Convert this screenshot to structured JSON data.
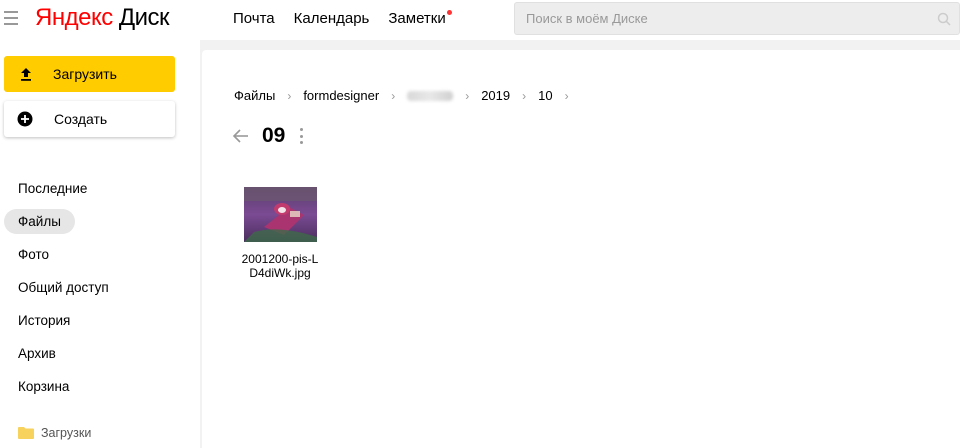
{
  "header": {
    "logo_brand_initial": "Я",
    "logo_brand_rest": "ндекс",
    "logo_product": "Диск",
    "nav": [
      "Почта",
      "Календарь",
      "Заметки"
    ],
    "search_placeholder": "Поиск в моём Диске"
  },
  "sidebar": {
    "upload_label": "Загрузить",
    "create_label": "Создать",
    "items": [
      {
        "label": "Последние",
        "active": false
      },
      {
        "label": "Файлы",
        "active": true
      },
      {
        "label": "Фото",
        "active": false
      },
      {
        "label": "Общий доступ",
        "active": false
      },
      {
        "label": "История",
        "active": false
      },
      {
        "label": "Архив",
        "active": false
      },
      {
        "label": "Корзина",
        "active": false
      }
    ],
    "folder_label": "Загрузки"
  },
  "main": {
    "breadcrumbs": [
      "Файлы",
      "formdesigner",
      "2019",
      "10"
    ],
    "folder_title": "09",
    "files": [
      {
        "name": "2001200-pis-LD4diWk.jpg",
        "name_line1": "2001200-pis-L",
        "name_line2": "D4diWk.jpg"
      }
    ]
  },
  "colors": {
    "accent_yellow": "#ffcc00",
    "notification_dot": "#ff3333",
    "logo_red": "#ff0000"
  }
}
